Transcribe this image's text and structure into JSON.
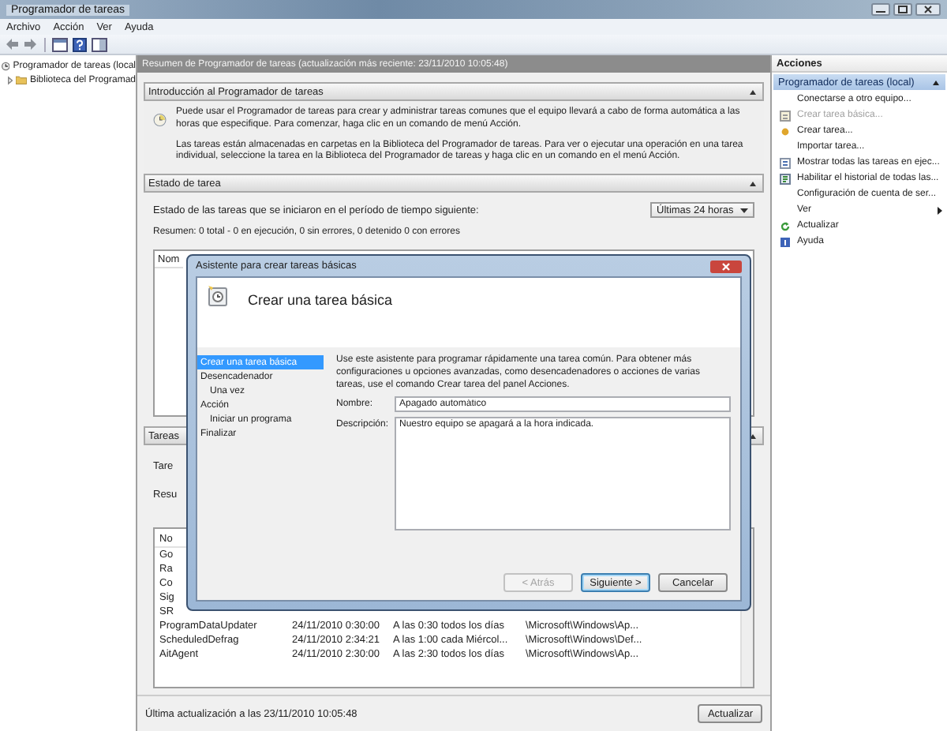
{
  "window": {
    "title": "Programador de tareas"
  },
  "menu": [
    "Archivo",
    "Acción",
    "Ver",
    "Ayuda"
  ],
  "tree": [
    {
      "label": "Programador de tareas (local",
      "children": [
        {
          "label": "Biblioteca del Programad"
        }
      ]
    }
  ],
  "summary_header": "Resumen de Programador de tareas (actualización más reciente: 23/11/2010 10:05:48)",
  "intro": {
    "title": "Introducción al Programador de tareas",
    "paragraphs": [
      "Puede usar el Programador de tareas para crear y administrar tareas comunes que el equipo llevará a cabo de forma automática a las horas que especifique. Para comenzar, haga clic en un comando de menú Acción.",
      "Las tareas están almacenadas en carpetas en la Biblioteca del Programador de tareas. Para ver o ejecutar una operación en una tarea individual, seleccione la tarea en la Biblioteca del Programador de tareas y haga clic en un comando en el menú Acción."
    ]
  },
  "status": {
    "title": "Estado de tarea",
    "prompt": "Estado de las tareas que se iniciaron en el período de tiempo siguiente:",
    "period": "Últimas 24 horas",
    "summary": "Resumen: 0 total - 0 en ejecución, 0 sin errores, 0 detenido 0 con errores",
    "list_header": "Nom"
  },
  "tasks": {
    "title": "Tareas",
    "lines": [
      "Tare",
      "Resu"
    ],
    "header": "No",
    "rows": [
      {
        "name": "Go"
      },
      {
        "name": "Ra"
      },
      {
        "name": "Co"
      },
      {
        "name": "Sig"
      },
      {
        "name": "SR"
      },
      {
        "name": "ProgramDataUpdater",
        "date": "24/11/2010 0:30:00",
        "trigger": "A las 0:30 todos los días",
        "path": "\\Microsoft\\Windows\\Ap..."
      },
      {
        "name": "ScheduledDefrag",
        "date": "24/11/2010 2:34:21",
        "trigger": "A las 1:00 cada Miércol...",
        "path": "\\Microsoft\\Windows\\Def..."
      },
      {
        "name": "AitAgent",
        "date": "24/11/2010 2:30:00",
        "trigger": "A las 2:30 todos los días",
        "path": "\\Microsoft\\Windows\\Ap..."
      }
    ]
  },
  "footer": {
    "text": "Última actualización a las 23/11/2010 10:05:48",
    "button": "Actualizar"
  },
  "actions": {
    "title": "Acciones",
    "group": "Programador de tareas (local)",
    "items": [
      {
        "label": "Conectarse a otro equipo...",
        "kind": "plain",
        "disabled": false
      },
      {
        "label": "Crear tarea básica...",
        "kind": "task",
        "disabled": true
      },
      {
        "label": "Crear tarea...",
        "kind": "new",
        "disabled": false
      },
      {
        "label": "Importar tarea...",
        "kind": "plain",
        "disabled": false
      },
      {
        "label": "Mostrar todas las tareas en ejec...",
        "kind": "list",
        "disabled": false
      },
      {
        "label": "Habilitar el historial de todas las...",
        "kind": "history",
        "disabled": false
      },
      {
        "label": "Configuración de cuenta de ser...",
        "kind": "plain",
        "disabled": false
      },
      {
        "label": "Ver",
        "kind": "submenu",
        "disabled": false
      },
      {
        "label": "Actualizar",
        "kind": "refresh",
        "disabled": false
      },
      {
        "label": "Ayuda",
        "kind": "help",
        "disabled": false
      }
    ]
  },
  "dialog": {
    "title": "Asistente para crear tareas básicas",
    "heading": "Crear una tarea básica",
    "steps": [
      {
        "label": "Crear una tarea básica",
        "selected": true
      },
      {
        "label": "Desencadenador",
        "selected": false,
        "children": [
          {
            "label": "Una vez",
            "selected": false
          }
        ]
      },
      {
        "label": "Acción",
        "selected": false,
        "children": [
          {
            "label": "Iniciar un programa",
            "selected": false
          }
        ]
      },
      {
        "label": "Finalizar",
        "selected": false
      }
    ],
    "intro": "Use este asistente para programar rápidamente una tarea común. Para obtener más configuraciones u opciones avanzadas, como desencadenadores o acciones de varias tareas, use el comando Crear tarea del panel Acciones.",
    "fields": [
      {
        "label": "Nombre:",
        "value": "Apagado automático",
        "kind": "line"
      },
      {
        "label": "Descripción:",
        "value": "Nuestro equipo se apagará a la hora indicada.",
        "kind": "area"
      }
    ],
    "buttons": [
      {
        "label": "< Atrás",
        "disabled": true,
        "default": false
      },
      {
        "label": "Siguiente >",
        "disabled": false,
        "default": true
      },
      {
        "label": "Cancelar",
        "disabled": false,
        "default": false
      }
    ]
  }
}
